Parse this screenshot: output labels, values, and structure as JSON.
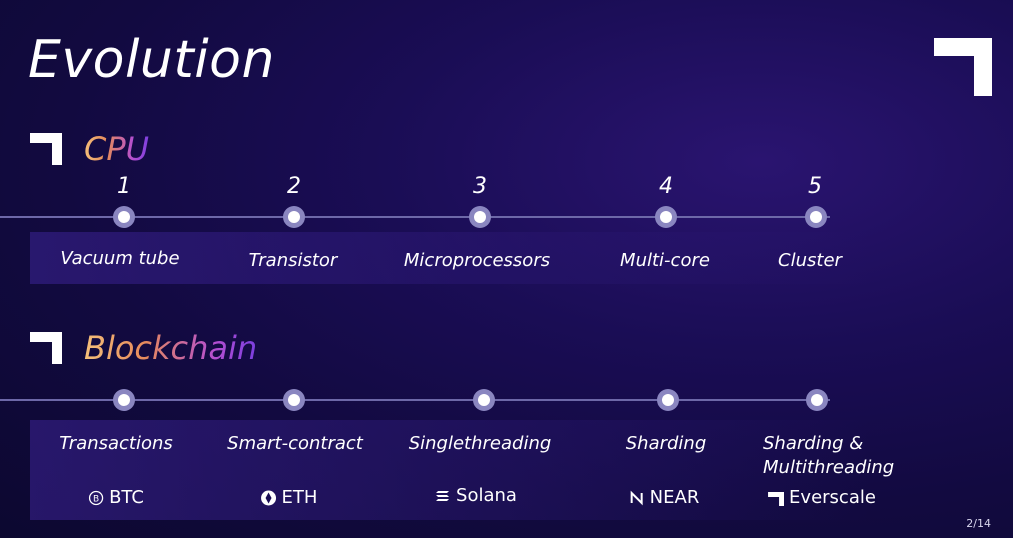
{
  "slide": {
    "title": "Evolution",
    "page": "2/14"
  },
  "cpu": {
    "label": "CPU",
    "steps": [
      {
        "num": "1",
        "label": "Vacuum tube"
      },
      {
        "num": "2",
        "label": "Transistor"
      },
      {
        "num": "3",
        "label": "Microprocessors"
      },
      {
        "num": "4",
        "label": "Multi-core"
      },
      {
        "num": "5",
        "label": "Cluster"
      }
    ]
  },
  "blockchain": {
    "label": "Blockchain",
    "steps": [
      {
        "label": "Transactions",
        "token": "BTC",
        "icon": "bitcoin-icon"
      },
      {
        "label": "Smart-contract",
        "token": "ETH",
        "icon": "ethereum-icon"
      },
      {
        "label": "Singlethreading",
        "token": "Solana",
        "icon": "solana-icon"
      },
      {
        "label": "Sharding",
        "token": "NEAR",
        "icon": "near-icon"
      },
      {
        "label_line1": "Sharding &",
        "label_line2": "Multithreading",
        "token": "Everscale",
        "icon": "everscale-icon"
      }
    ]
  },
  "colors": {
    "background": "#120a40",
    "accent_start": "#f5c07a",
    "accent_end": "#7b3fe0",
    "node": "#8a86c0"
  }
}
